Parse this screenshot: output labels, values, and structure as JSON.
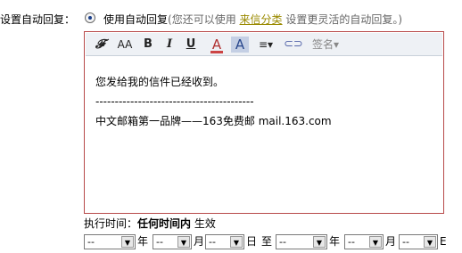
{
  "setting": {
    "label": "设置自动回复：",
    "option": "使用自动回复",
    "hint_before": "(您还可以使用",
    "hint_link": "来信分类",
    "hint_after": "设置更灵活的自动回复。)"
  },
  "toolbar": {
    "font": "𝓕",
    "size": "AA",
    "bold": "B",
    "italic": "I",
    "underline": "U",
    "font_color": "A",
    "bg_color": "A",
    "align": "≡▾",
    "link": "⊂⊃",
    "signature": "签名▾"
  },
  "content": {
    "line1": "您发给我的信件已经收到。",
    "line2": "-----------------------------------------",
    "line3": "中文邮箱第一品牌——163免费邮 mail.163.com"
  },
  "exec": {
    "prefix": "执行时间：",
    "bold": "任何时间内",
    "suffix": "生效"
  },
  "date_range": {
    "placeholder": "--",
    "year": "年",
    "month": "月",
    "day": "日",
    "to": "至",
    "end_day_clipped": "E"
  }
}
